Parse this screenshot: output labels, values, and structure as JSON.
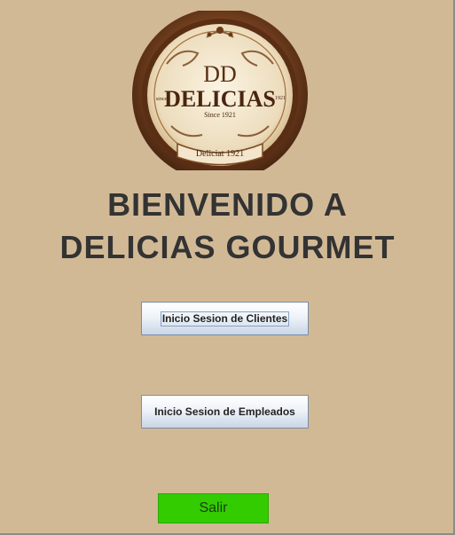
{
  "logo": {
    "monogram": "DD",
    "brand": "DELICIAS",
    "since_left": "since",
    "year_right": "1921",
    "since_text": "Since 1921",
    "ribbon_text": "Deliciat 1921"
  },
  "welcome": {
    "line1": "BIENVENIDO A",
    "line2": "DELICIAS GOURMET"
  },
  "buttons": {
    "clientes": "Inicio Sesion de Clientes",
    "empleados": "Inicio Sesion de Empleados",
    "salir": "Salir"
  },
  "colors": {
    "background": "#d2b996",
    "salir": "#33cc00"
  }
}
